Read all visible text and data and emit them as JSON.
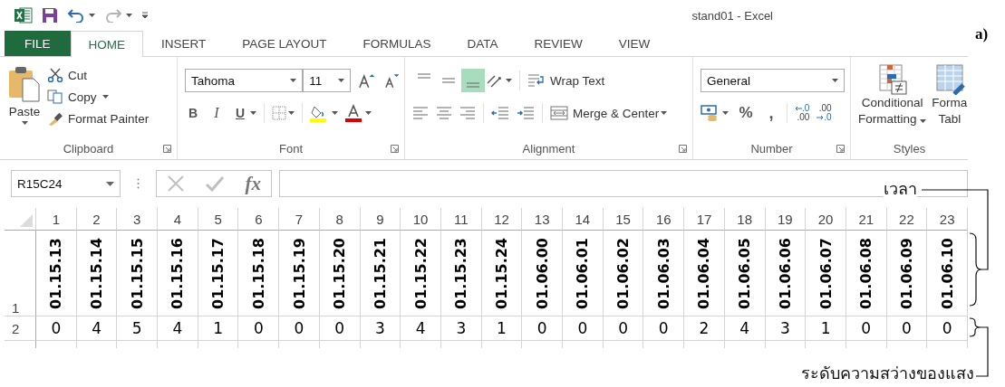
{
  "window": {
    "title": "stand01 - Excel"
  },
  "figure_label": "a)",
  "ribbon_tabs": [
    {
      "label": "FILE",
      "kind": "file",
      "selected": false
    },
    {
      "label": "HOME",
      "kind": "tab",
      "selected": true
    },
    {
      "label": "INSERT",
      "kind": "tab",
      "selected": false
    },
    {
      "label": "PAGE LAYOUT",
      "kind": "tab",
      "selected": false
    },
    {
      "label": "FORMULAS",
      "kind": "tab",
      "selected": false
    },
    {
      "label": "DATA",
      "kind": "tab",
      "selected": false
    },
    {
      "label": "REVIEW",
      "kind": "tab",
      "selected": false
    },
    {
      "label": "VIEW",
      "kind": "tab",
      "selected": false
    }
  ],
  "clipboard": {
    "label": "Clipboard",
    "paste": "Paste",
    "cut": "Cut",
    "copy": "Copy",
    "format_painter": "Format Painter"
  },
  "font": {
    "label": "Font",
    "name": "Tahoma",
    "size": "11",
    "bold": "B",
    "italic": "I",
    "underline": "U"
  },
  "alignment": {
    "label": "Alignment",
    "vertical_align": [
      {
        "selected": false
      },
      {
        "selected": false
      },
      {
        "selected": true
      }
    ],
    "wrap_text": "Wrap Text",
    "merge_center": "Merge & Center"
  },
  "number": {
    "label": "Number",
    "format": "General",
    "percent": "%",
    "comma": ",",
    "increase_decimal": [
      ".0",
      ".00"
    ],
    "decrease_decimal": [
      ".00",
      ".0"
    ]
  },
  "styles": {
    "label": "Styles",
    "conditional_formatting": [
      "Conditional",
      "Formatting"
    ],
    "format_as_table": [
      "Forma",
      "Tabl"
    ]
  },
  "formula_bar": {
    "name_box": "R15C24",
    "fx": "fx"
  },
  "sheet": {
    "columns": [
      "1",
      "2",
      "3",
      "4",
      "5",
      "6",
      "7",
      "8",
      "9",
      "10",
      "11",
      "12",
      "13",
      "14",
      "15",
      "16",
      "17",
      "18",
      "19",
      "20",
      "21",
      "22",
      "23"
    ],
    "rows": [
      {
        "header": "1",
        "kind": "vertical",
        "cells": [
          "01.15.13",
          "01.15.14",
          "01.15.15",
          "01.15.16",
          "01.15.17",
          "01.15.18",
          "01.15.19",
          "01.15.20",
          "01.15.21",
          "01.15.22",
          "01.15.23",
          "01.15.24",
          "01.06.00",
          "01.06.01",
          "01.06.02",
          "01.06.03",
          "01.06.04",
          "01.06.05",
          "01.06.06",
          "01.06.07",
          "01.06.08",
          "01.06.09",
          "01.06.10"
        ]
      },
      {
        "header": "2",
        "kind": "plain",
        "cells": [
          "0",
          "4",
          "5",
          "4",
          "1",
          "0",
          "0",
          "0",
          "3",
          "4",
          "3",
          "1",
          "0",
          "0",
          "0",
          "0",
          "2",
          "4",
          "3",
          "1",
          "0",
          "0",
          "0"
        ]
      }
    ]
  },
  "annotations": [
    {
      "label": "เวลา"
    },
    {
      "label": "ระดับความสว่างของแสง"
    }
  ]
}
